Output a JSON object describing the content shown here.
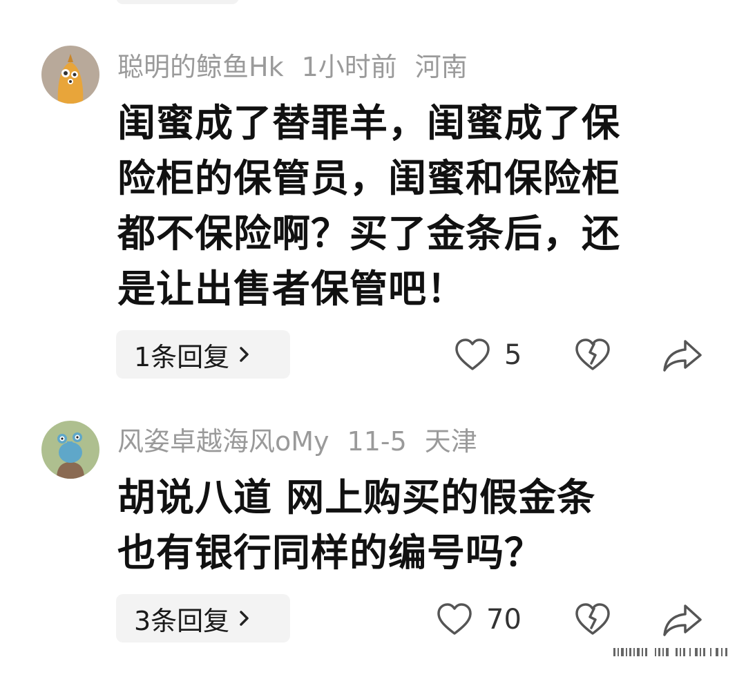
{
  "comments": [
    {
      "username": "聪明的鲸鱼Hk",
      "time": "1小时前",
      "location": "河南",
      "avatar_icon": "owl-avatar-icon",
      "text_lines": [
        "闺蜜成了替罪羊，闺蜜成了保",
        "险柜的保管员，闺蜜和保险柜",
        "都不保险啊？买了金条后，还",
        "是让出售者保管吧！"
      ],
      "reply_label": "1条回复",
      "likes": "5"
    },
    {
      "username": "风姿卓越海风oMy",
      "time": "11-5",
      "location": "天津",
      "avatar_icon": "creature-avatar-icon",
      "text_lines": [
        "胡说八道 网上购买的假金条",
        "也有银行同样的编号吗？"
      ],
      "reply_label": "3条回复",
      "likes": "70"
    }
  ],
  "colors": {
    "meta": "#9a9a9a",
    "reply_bg": "#f3f3f3",
    "icon": "#555555"
  }
}
